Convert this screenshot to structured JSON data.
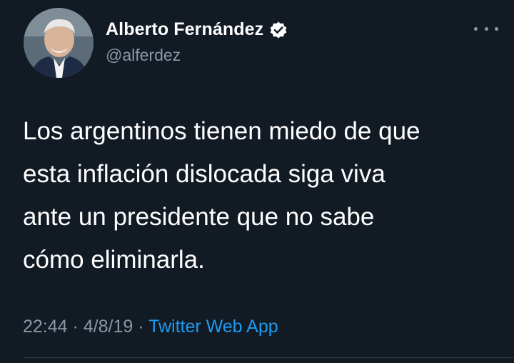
{
  "author": {
    "display_name": "Alberto Fernández",
    "handle": "@alferdez",
    "verified": true,
    "avatar_icon": "profile-photo"
  },
  "tweet": {
    "lines": [
      "Los argentinos tienen miedo de que",
      "esta inflación dislocada siga viva",
      "ante un presidente que no sabe",
      "cómo eliminarla."
    ],
    "time": "22:44",
    "sep1": " · ",
    "date": "4/8/19",
    "sep2": " · ",
    "source": "Twitter Web App"
  },
  "icons": {
    "more": "more-horizontal-icon",
    "verified": "verified-badge-icon"
  },
  "colors": {
    "background": "#121a24",
    "text": "#ffffff",
    "secondary": "#8b98a5",
    "accent": "#1d9bf0"
  }
}
